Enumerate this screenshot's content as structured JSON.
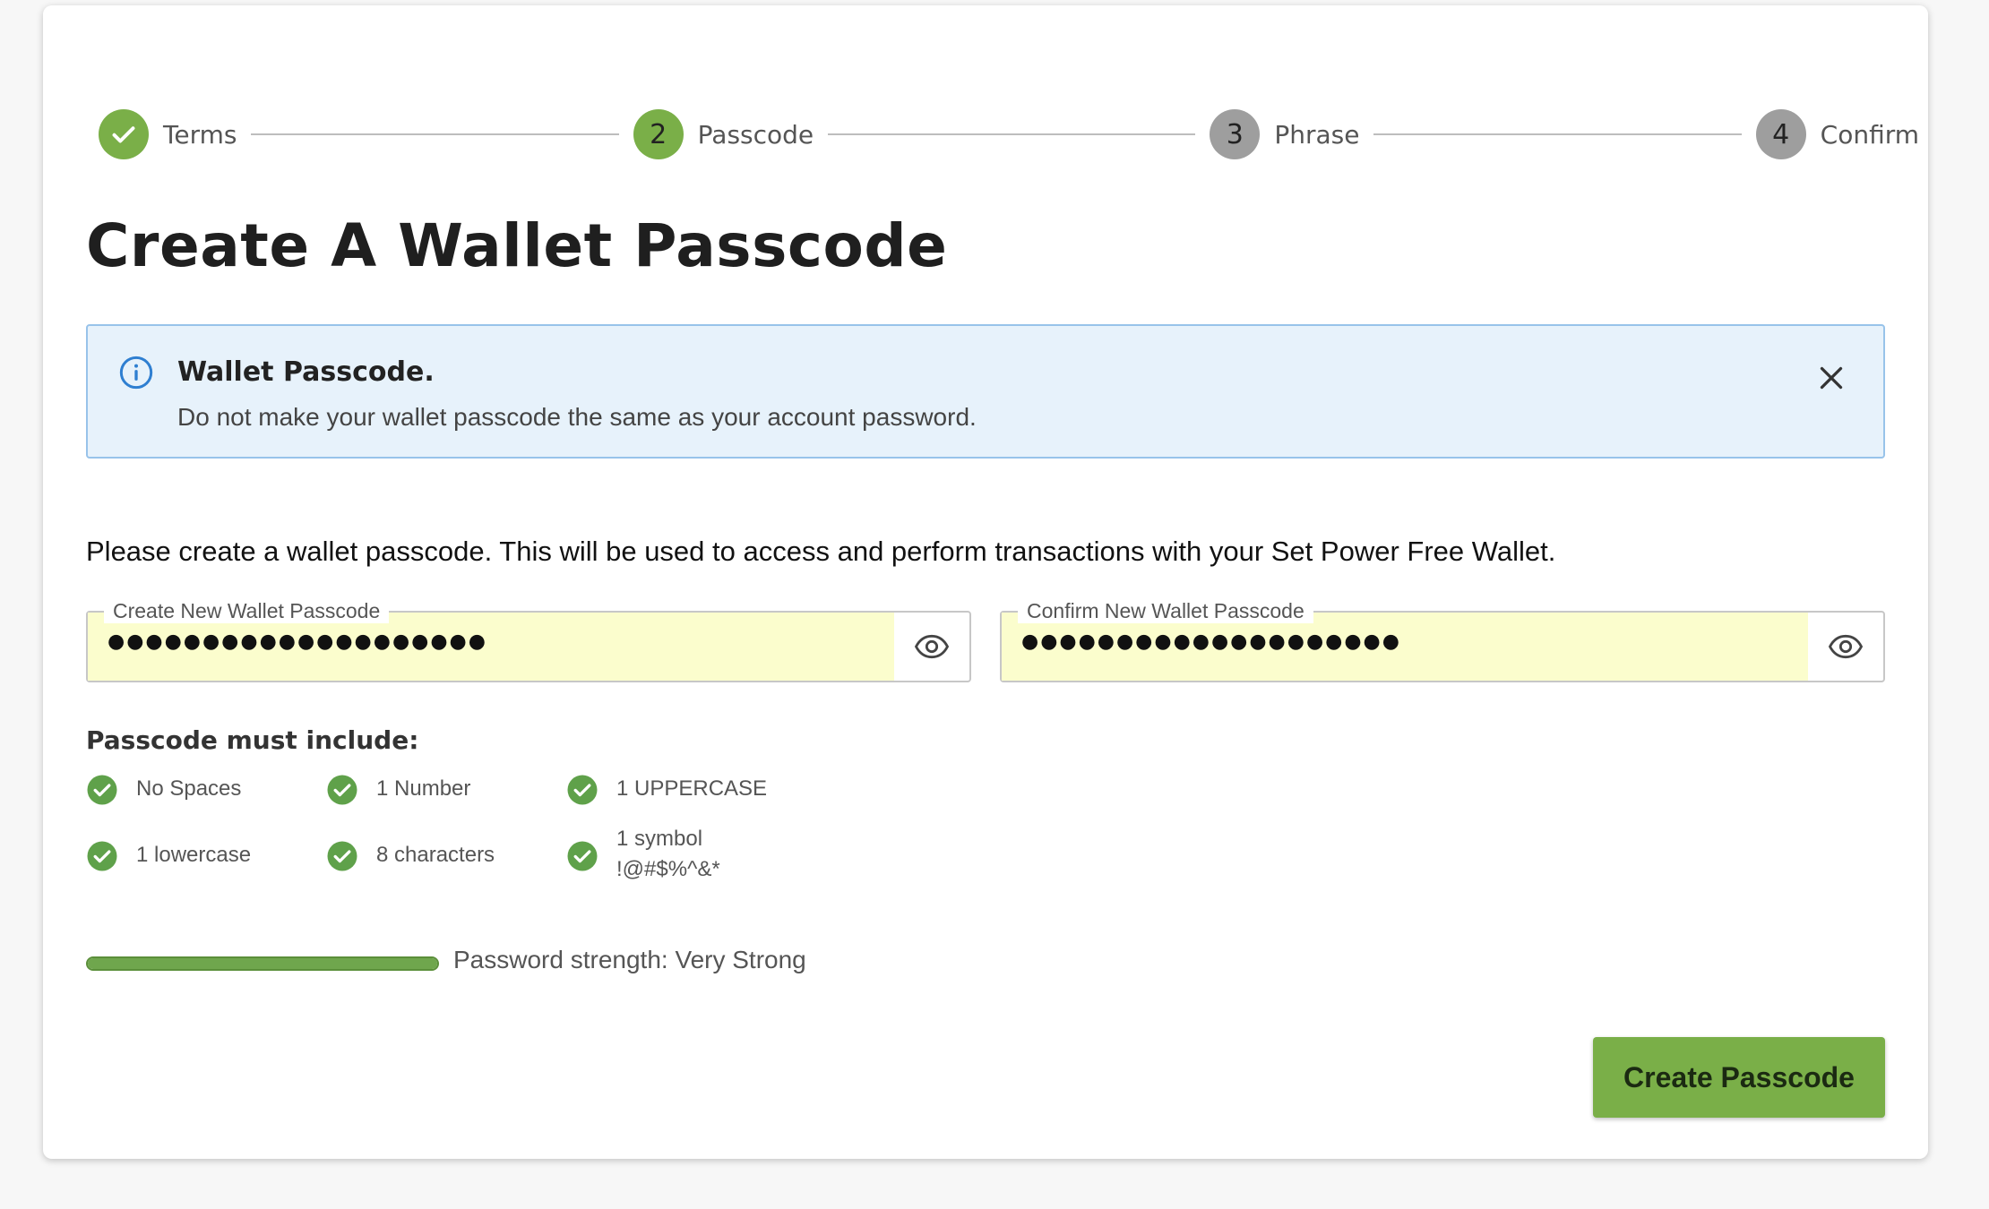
{
  "stepper": {
    "steps": [
      {
        "label": "Terms",
        "number": "1",
        "state": "done"
      },
      {
        "label": "Passcode",
        "number": "2",
        "state": "active"
      },
      {
        "label": "Phrase",
        "number": "3",
        "state": "pending"
      },
      {
        "label": "Confirm",
        "number": "4",
        "state": "pending"
      }
    ]
  },
  "page": {
    "title": "Create A Wallet Passcode",
    "intro": "Please create a wallet passcode. This will be used to access and perform transactions with your Set Power Free Wallet."
  },
  "alert": {
    "title": "Wallet Passcode.",
    "text": "Do not make your wallet passcode the same as your account password.",
    "icon": "info-icon"
  },
  "fields": {
    "create": {
      "label": "Create New Wallet Passcode",
      "value": "●●●●●●●●●●●●●●●●●●●●"
    },
    "confirm": {
      "label": "Confirm New Wallet Passcode",
      "value": "●●●●●●●●●●●●●●●●●●●●"
    }
  },
  "requirements": {
    "title": "Passcode must include:",
    "items": [
      {
        "text": "No Spaces",
        "met": true
      },
      {
        "text": "1 Number",
        "met": true
      },
      {
        "text": "1 UPPERCASE",
        "met": true
      },
      {
        "text": "1 lowercase",
        "met": true
      },
      {
        "text": "8 characters",
        "met": true
      },
      {
        "text": "1 symbol",
        "sub": "!@#$%^&*",
        "met": true
      }
    ]
  },
  "strength": {
    "label": "Password strength: Very Strong",
    "level": 1.0
  },
  "actions": {
    "primary_label": "Create Passcode"
  },
  "colors": {
    "accent": "#7aaf48",
    "pending": "#9e9e9e",
    "alert_bg": "#e7f2fb",
    "alert_border": "#98c3ea",
    "autofill": "#fbfdcd"
  }
}
